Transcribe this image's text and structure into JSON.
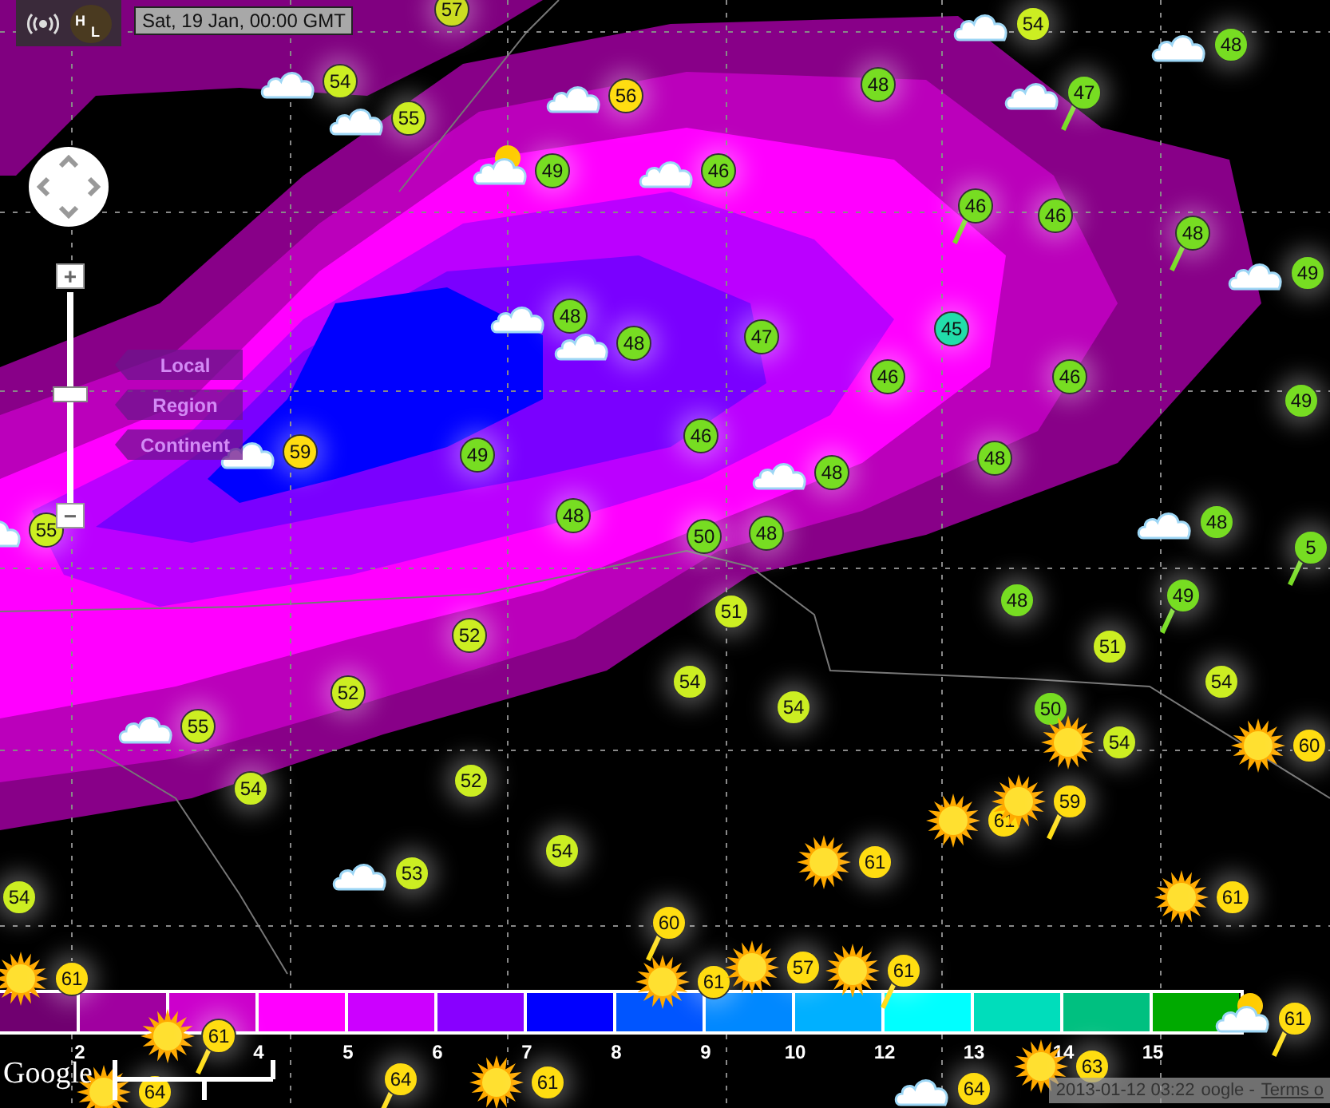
{
  "toolbar": {
    "pressure_button": {
      "high": "H",
      "low": "L"
    },
    "date": "Sat, 19 Jan, 00:00 GMT"
  },
  "zoom": {
    "plus": "+",
    "minus": "−",
    "level": 0.52
  },
  "map_types": [
    {
      "label": "Local"
    },
    {
      "label": "Region"
    },
    {
      "label": "Continent"
    }
  ],
  "stations": [
    {
      "value": "57",
      "color": "#ccdd22",
      "kind": "plain",
      "stem": false
    },
    {
      "value": "54",
      "color": "#ccee22",
      "kind": "cloud",
      "stem": false
    },
    {
      "value": "48",
      "color": "#77dd22",
      "kind": "cloud",
      "stem": false
    },
    {
      "value": "54",
      "color": "#ccee22",
      "kind": "cloud",
      "stem": false
    },
    {
      "value": "55",
      "color": "#ccee22",
      "kind": "cloud",
      "stem": false
    },
    {
      "value": "56",
      "color": "#ffdd11",
      "kind": "cloud",
      "stem": false
    },
    {
      "value": "48",
      "color": "#77dd22",
      "kind": "plain",
      "stem": false
    },
    {
      "value": "47",
      "color": "#77dd22",
      "kind": "cloud",
      "stem": true
    },
    {
      "value": "49",
      "color": "#77dd22",
      "kind": "cloud-sun",
      "stem": false
    },
    {
      "value": "46",
      "color": "#77dd22",
      "kind": "cloud",
      "stem": false
    },
    {
      "value": "46",
      "color": "#77dd22",
      "kind": "plain",
      "stem": true
    },
    {
      "value": "46",
      "color": "#77dd22",
      "kind": "plain",
      "stem": false
    },
    {
      "value": "48",
      "color": "#77dd22",
      "kind": "plain",
      "stem": true
    },
    {
      "value": "49",
      "color": "#77dd22",
      "kind": "cloud",
      "stem": false
    },
    {
      "value": "48",
      "color": "#77dd22",
      "kind": "cloud",
      "stem": false
    },
    {
      "value": "48",
      "color": "#77dd22",
      "kind": "cloud",
      "stem": false
    },
    {
      "value": "47",
      "color": "#77dd22",
      "kind": "plain",
      "stem": false
    },
    {
      "value": "45",
      "color": "#22ddaa",
      "kind": "plain",
      "stem": false
    },
    {
      "value": "46",
      "color": "#77dd22",
      "kind": "plain",
      "stem": false
    },
    {
      "value": "46",
      "color": "#77dd22",
      "kind": "plain",
      "stem": false
    },
    {
      "value": "49",
      "color": "#77dd22",
      "kind": "plain",
      "stem": false
    },
    {
      "value": "59",
      "color": "#ffdd11",
      "kind": "cloud",
      "stem": false
    },
    {
      "value": "49",
      "color": "#77dd22",
      "kind": "plain",
      "stem": false
    },
    {
      "value": "46",
      "color": "#77dd22",
      "kind": "plain",
      "stem": false
    },
    {
      "value": "48",
      "color": "#77dd22",
      "kind": "cloud",
      "stem": false
    },
    {
      "value": "48",
      "color": "#77dd22",
      "kind": "plain",
      "stem": false
    },
    {
      "value": "55",
      "color": "#ccee22",
      "kind": "cloud",
      "stem": false
    },
    {
      "value": "48",
      "color": "#77dd22",
      "kind": "plain",
      "stem": false
    },
    {
      "value": "50",
      "color": "#77dd22",
      "kind": "plain",
      "stem": false
    },
    {
      "value": "48",
      "color": "#77dd22",
      "kind": "plain",
      "stem": false
    },
    {
      "value": "48",
      "color": "#77dd22",
      "kind": "cloud",
      "stem": false
    },
    {
      "value": "5",
      "color": "#77dd22",
      "kind": "plain",
      "stem": true
    },
    {
      "value": "51",
      "color": "#ccee22",
      "kind": "plain",
      "stem": false
    },
    {
      "value": "48",
      "color": "#77dd22",
      "kind": "plain",
      "stem": false
    },
    {
      "value": "49",
      "color": "#77dd22",
      "kind": "plain",
      "stem": true
    },
    {
      "value": "52",
      "color": "#ccee22",
      "kind": "plain",
      "stem": false
    },
    {
      "value": "51",
      "color": "#ccee22",
      "kind": "plain",
      "stem": false
    },
    {
      "value": "52",
      "color": "#ccee22",
      "kind": "plain",
      "stem": false
    },
    {
      "value": "54",
      "color": "#ccee22",
      "kind": "plain",
      "stem": false
    },
    {
      "value": "54",
      "color": "#ccee22",
      "kind": "plain",
      "stem": false
    },
    {
      "value": "54",
      "color": "#ccee22",
      "kind": "plain",
      "stem": false
    },
    {
      "value": "55",
      "color": "#ccee22",
      "kind": "cloud",
      "stem": false
    },
    {
      "value": "50",
      "color": "#77dd22",
      "kind": "plain",
      "stem": false
    },
    {
      "value": "54",
      "color": "#ccee22",
      "kind": "sun",
      "stem": false
    },
    {
      "value": "60",
      "color": "#ffdd11",
      "kind": "sun",
      "stem": false
    },
    {
      "value": "54",
      "color": "#ccee22",
      "kind": "plain",
      "stem": false
    },
    {
      "value": "52",
      "color": "#ccee22",
      "kind": "plain",
      "stem": false
    },
    {
      "value": "61",
      "color": "#ffdd11",
      "kind": "sun",
      "stem": false
    },
    {
      "value": "59",
      "color": "#ffdd11",
      "kind": "sun",
      "stem": true
    },
    {
      "value": "61",
      "color": "#ffdd11",
      "kind": "sun",
      "stem": false
    },
    {
      "value": "54",
      "color": "#ccee22",
      "kind": "plain",
      "stem": false
    },
    {
      "value": "53",
      "color": "#ccee22",
      "kind": "cloud",
      "stem": false
    },
    {
      "value": "61",
      "color": "#ffdd11",
      "kind": "sun",
      "stem": false
    },
    {
      "value": "54",
      "color": "#ccee22",
      "kind": "plain",
      "stem": false
    },
    {
      "value": "60",
      "color": "#ffdd11",
      "kind": "plain",
      "stem": true
    },
    {
      "value": "61",
      "color": "#ffdd11",
      "kind": "sun",
      "stem": false
    },
    {
      "value": "61",
      "color": "#ffdd11",
      "kind": "sun",
      "stem": false
    },
    {
      "value": "57",
      "color": "#ffdd11",
      "kind": "sun",
      "stem": false
    },
    {
      "value": "61",
      "color": "#ffdd11",
      "kind": "sun",
      "stem": true
    },
    {
      "value": "61",
      "color": "#ffdd11",
      "kind": "sun",
      "stem": true
    },
    {
      "value": "61",
      "color": "#ffdd11",
      "kind": "cloud-sun",
      "stem": true
    },
    {
      "value": "63",
      "color": "#ffdd11",
      "kind": "sun",
      "stem": false
    },
    {
      "value": "64",
      "color": "#ffdd11",
      "kind": "sun",
      "stem": false
    },
    {
      "value": "64",
      "color": "#ffdd11",
      "kind": "plain",
      "stem": true
    },
    {
      "value": "61",
      "color": "#ffdd11",
      "kind": "sun",
      "stem": false
    },
    {
      "value": "64",
      "color": "#ffdd11",
      "kind": "cloud",
      "stem": false
    }
  ],
  "legend": {
    "swatches": [
      {
        "color": "#700070"
      },
      {
        "color": "#a000a0",
        "label": "2"
      },
      {
        "color": "#cc00cc"
      },
      {
        "color": "#ff00ff",
        "label": "4"
      },
      {
        "color": "#cc00ff",
        "label": "5"
      },
      {
        "color": "#8800ff",
        "label": "6"
      },
      {
        "color": "#0000ff",
        "label": "7"
      },
      {
        "color": "#0055ff",
        "label": "8"
      },
      {
        "color": "#0088ff",
        "label": "9"
      },
      {
        "color": "#00b0ff",
        "label": "10"
      },
      {
        "color": "#00ffff",
        "label": "12"
      },
      {
        "color": "#00ddbb",
        "label": "13"
      },
      {
        "color": "#00c080",
        "label": "14"
      },
      {
        "color": "#00aa00",
        "label": "15"
      }
    ]
  },
  "footer": {
    "logo": "Google",
    "timestamp": "2013-01-12 03:22",
    "attribution": "oogle -",
    "terms_link": "Terms o"
  }
}
